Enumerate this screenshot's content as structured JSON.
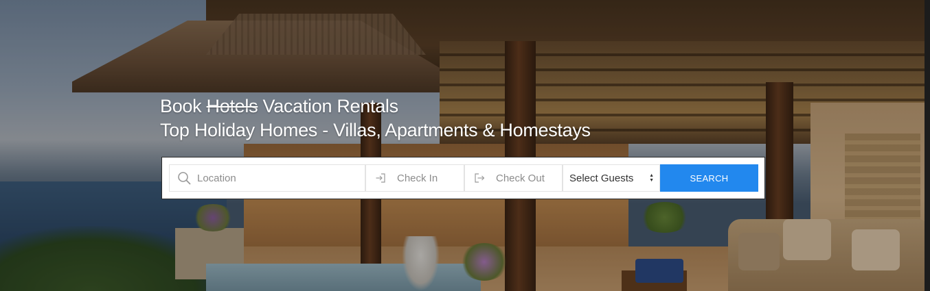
{
  "hero": {
    "headline_line1_before": "Book",
    "headline_line1_struck": "Hotels",
    "headline_line1_after": "Vacation Rentals",
    "headline_line2": "Top Holiday Homes - Villas, Apartments & Homestays"
  },
  "search": {
    "location_placeholder": "Location",
    "check_in_placeholder": "Check In",
    "check_out_placeholder": "Check Out",
    "guests_selected": "Select Guests",
    "button_label": "SEARCH",
    "icons": {
      "location": "search-icon",
      "check_in": "check-in-arrow-icon",
      "check_out": "check-out-arrow-icon",
      "guests": "sort-arrows-icon"
    }
  },
  "colors": {
    "accent": "#2288ee",
    "headline_text": "#ffffff",
    "placeholder_text": "#8c8c8c"
  }
}
